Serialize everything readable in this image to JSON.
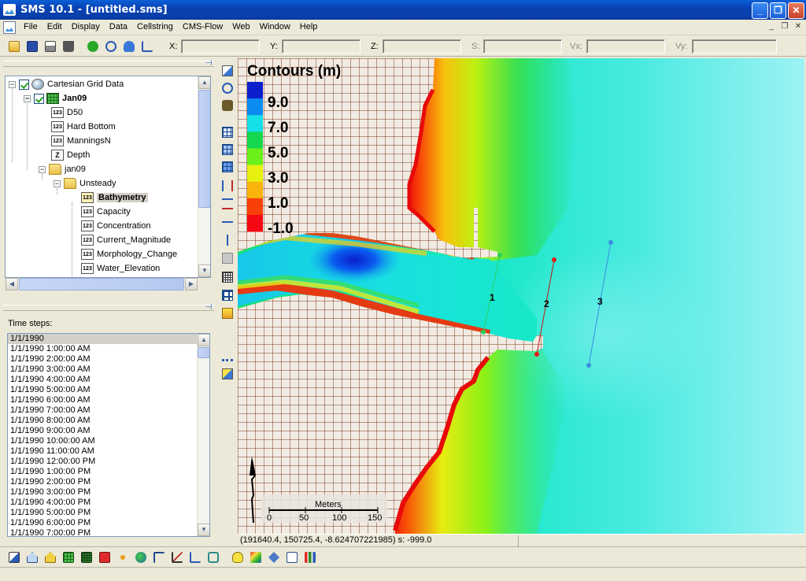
{
  "window": {
    "title": "SMS 10.1 - [untitled.sms]"
  },
  "menu": [
    "File",
    "Edit",
    "Display",
    "Data",
    "Cellstring",
    "CMS-Flow",
    "Web",
    "Window",
    "Help"
  ],
  "coords": {
    "x_label": "X:",
    "y_label": "Y:",
    "z_label": "Z:",
    "s_label": "S:",
    "vx_label": "Vx:",
    "vy_label": "Vy:"
  },
  "tree": {
    "root": "Cartesian Grid Data",
    "grid": "Jan09",
    "items": [
      "D50",
      "Hard Bottom",
      "ManningsN",
      "Depth"
    ],
    "folder": "jan09",
    "subfolder": "Unsteady",
    "datasets": [
      "Bathymetry",
      "Capacity",
      "Concentration",
      "Current_Magnitude",
      "Morphology_Change",
      "Water_Elevation"
    ]
  },
  "timesteps": {
    "label": "Time steps:",
    "items": [
      "1/1/1990",
      "1/1/1990 1:00:00 AM",
      "1/1/1990 2:00:00 AM",
      "1/1/1990 3:00:00 AM",
      "1/1/1990 4:00:00 AM",
      "1/1/1990 5:00:00 AM",
      "1/1/1990 6:00:00 AM",
      "1/1/1990 7:00:00 AM",
      "1/1/1990 8:00:00 AM",
      "1/1/1990 9:00:00 AM",
      "1/1/1990 10:00:00 AM",
      "1/1/1990 11:00:00 AM",
      "1/1/1990 12:00:00 PM",
      "1/1/1990 1:00:00 PM",
      "1/1/1990 2:00:00 PM",
      "1/1/1990 3:00:00 PM",
      "1/1/1990 4:00:00 PM",
      "1/1/1990 5:00:00 PM",
      "1/1/1990 6:00:00 PM",
      "1/1/1990 7:00:00 PM"
    ]
  },
  "legend": {
    "title": "Contours (m)",
    "labels": [
      "9.0",
      "7.0",
      "5.0",
      "3.0",
      "1.0",
      "-1.0"
    ],
    "colors": [
      "#0a1ecc",
      "#0c8cf0",
      "#16e0e8",
      "#16d850",
      "#6cf01c",
      "#e8f010",
      "#f8b40c",
      "#f84008",
      "#f40814"
    ]
  },
  "scalebar": {
    "unit": "Meters",
    "ticks": [
      "0",
      "50",
      "100",
      "150"
    ]
  },
  "observation_arcs": [
    "1",
    "2",
    "3"
  ],
  "status": {
    "cursor": "(191640.4, 150725.4, -8.624707221985) s: -999.0"
  }
}
